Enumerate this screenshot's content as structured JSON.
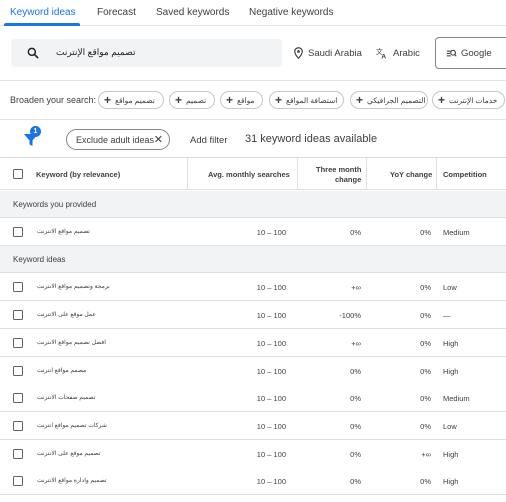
{
  "tabs": [
    {
      "label": "Keyword ideas",
      "active": true
    },
    {
      "label": "Forecast",
      "active": false
    },
    {
      "label": "Saved keywords",
      "active": false
    },
    {
      "label": "Negative keywords",
      "active": false
    }
  ],
  "search": {
    "value": "تصميم مواقع الإنترنت"
  },
  "location": "Saudi Arabia",
  "language": "Arabic",
  "engine": "Google",
  "broaden": {
    "label": "Broaden your search:",
    "chips": [
      "تصميم مواقع",
      "تصميم",
      "مواقع",
      "استضافة المواقع",
      "التصميم الجرافيكي",
      "خدمات الإنترنت"
    ]
  },
  "filter": {
    "badge_count": "1",
    "exclude_label": "Exclude adult ideas",
    "add_filter": "Add filter",
    "ideas_count": "31 keyword ideas available"
  },
  "table": {
    "headers": {
      "keyword": "Keyword (by relevance)",
      "searches": "Avg. monthly searches",
      "three_month_1": "Three month",
      "three_month_2": "change",
      "yoy": "YoY change",
      "competition": "Competition"
    },
    "provided_label": "Keywords you provided",
    "ideas_label": "Keyword ideas",
    "provided": [
      {
        "keyword": "تصميم مواقع الانترنت",
        "searches": "10 – 100",
        "three_month": "0%",
        "yoy": "0%",
        "competition": "Medium"
      }
    ],
    "ideas": [
      {
        "keyword": "برمجة وتصميم مواقع الانترنت",
        "searches": "10 – 100",
        "three_month": "+∞",
        "yoy": "0%",
        "competition": "Low"
      },
      {
        "keyword": "عمل موقع على الانترنت",
        "searches": "10 – 100",
        "three_month": "-100%",
        "yoy": "0%",
        "competition": "—"
      },
      {
        "keyword": "افضل تصميم مواقع الانترنت",
        "searches": "10 – 100",
        "three_month": "+∞",
        "yoy": "0%",
        "competition": "High"
      },
      {
        "keyword": "مصمم مواقع انترنت",
        "searches": "10 – 100",
        "three_month": "0%",
        "yoy": "0%",
        "competition": "High"
      },
      {
        "keyword": "تصميم صفحات الانترنت",
        "searches": "10 – 100",
        "three_month": "0%",
        "yoy": "0%",
        "competition": "Medium"
      },
      {
        "keyword": "شركات تصميم مواقع انترنت",
        "searches": "10 – 100",
        "three_month": "0%",
        "yoy": "0%",
        "competition": "Low"
      },
      {
        "keyword": "تصميم موقع على الانترنت",
        "searches": "10 – 100",
        "three_month": "0%",
        "yoy": "+∞",
        "competition": "High"
      },
      {
        "keyword": "تصميم وادارة مواقع الانترنت",
        "searches": "10 – 100",
        "three_month": "0%",
        "yoy": "0%",
        "competition": "High"
      }
    ]
  },
  "colors": {
    "accent": "#1a73e8",
    "section_bg": "#f1f3f4",
    "border": "#dadce0"
  }
}
